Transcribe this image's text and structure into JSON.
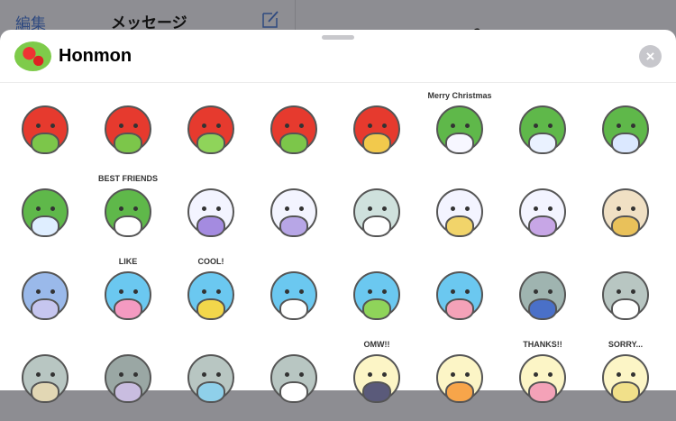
{
  "background": {
    "edit_label": "編集",
    "title": "メッセージ",
    "partial_text": "?"
  },
  "sheet": {
    "pack_name": "Honmon",
    "close_icon": "×"
  },
  "stickers": [
    {
      "body": "#e63a2e",
      "belly": "#7cc64a"
    },
    {
      "body": "#e63a2e",
      "belly": "#7cc64a"
    },
    {
      "body": "#e63a2e",
      "belly": "#8fd45a"
    },
    {
      "body": "#e63a2e",
      "belly": "#7cc64a"
    },
    {
      "body": "#e63a2e",
      "belly": "#f2c94c"
    },
    {
      "body": "#5fb84a",
      "belly": "#f7f7ff",
      "caption": "Merry Christmas"
    },
    {
      "body": "#5fb84a",
      "belly": "#eaf2ff"
    },
    {
      "body": "#5fb84a",
      "belly": "#dbe8ff"
    },
    {
      "body": "#5fb84a",
      "belly": "#dfeeff"
    },
    {
      "body": "#5fb84a",
      "belly": "#ffffff",
      "caption": "BEST FRIENDS"
    },
    {
      "body": "#f3f4ff",
      "belly": "#a48be0"
    },
    {
      "body": "#f3f4ff",
      "belly": "#b7a6e6"
    },
    {
      "body": "#cfe1dd",
      "belly": "#ffffff"
    },
    {
      "body": "#f3f4ff",
      "belly": "#f1d46a"
    },
    {
      "body": "#f3f4ff",
      "belly": "#c7a6e6"
    },
    {
      "body": "#f0e0c4",
      "belly": "#e9c15a"
    },
    {
      "body": "#9ab9ea",
      "belly": "#c6c6ef"
    },
    {
      "body": "#6bc8f0",
      "belly": "#f49ac1",
      "caption": "LIKE"
    },
    {
      "body": "#6bc8f0",
      "belly": "#f2d74b",
      "caption": "COOL!"
    },
    {
      "body": "#6bc8f0",
      "belly": "#ffffff"
    },
    {
      "body": "#6bc8f0",
      "belly": "#8fd45a"
    },
    {
      "body": "#6bc8f0",
      "belly": "#f4a2b8"
    },
    {
      "body": "#9fb4b0",
      "belly": "#4a70c8"
    },
    {
      "body": "#b8c6c2",
      "belly": "#ffffff"
    },
    {
      "body": "#b8c6c2",
      "belly": "#e2d7b4"
    },
    {
      "body": "#9aa7a4",
      "belly": "#c9bde0"
    },
    {
      "body": "#b8c6c2",
      "belly": "#8fd0ea"
    },
    {
      "body": "#b8c6c2",
      "belly": "#ffffff"
    },
    {
      "body": "#fcf5c6",
      "belly": "#5a5a7a",
      "caption": "OMW!!"
    },
    {
      "body": "#fcf5c6",
      "belly": "#f7a54a"
    },
    {
      "body": "#fcf5c6",
      "belly": "#f4a2b8",
      "caption": "THANKS!!"
    },
    {
      "body": "#fcf5c6",
      "belly": "#f1e08a",
      "caption": "SORRY..."
    }
  ]
}
